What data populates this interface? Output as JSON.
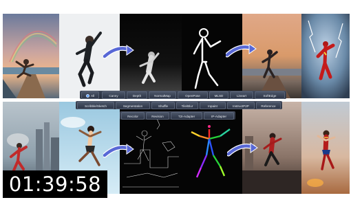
{
  "video": {
    "timestamp": "01:39:58"
  },
  "controlnet": {
    "selected": "All",
    "row1": [
      "All",
      "Canny",
      "Depth",
      "NormalMap",
      "OpenPose",
      "MLSD",
      "Lineart",
      "SoftEdge"
    ],
    "row2": [
      "Scribble/Sketch",
      "Segmentation",
      "Shuffle",
      "Tile/Blur",
      "Inpaint",
      "InstructP2P",
      "Reference"
    ],
    "row3": [
      "Recolor",
      "Revision",
      "T2I-Adapter",
      "IP-Adapter"
    ]
  },
  "colors": {
    "tag_bg": "#2d3546",
    "arrow": "#6a7be0",
    "pose_red": "#ff2a2a",
    "pose_green": "#27d23a",
    "pose_blue": "#2a54ff"
  }
}
